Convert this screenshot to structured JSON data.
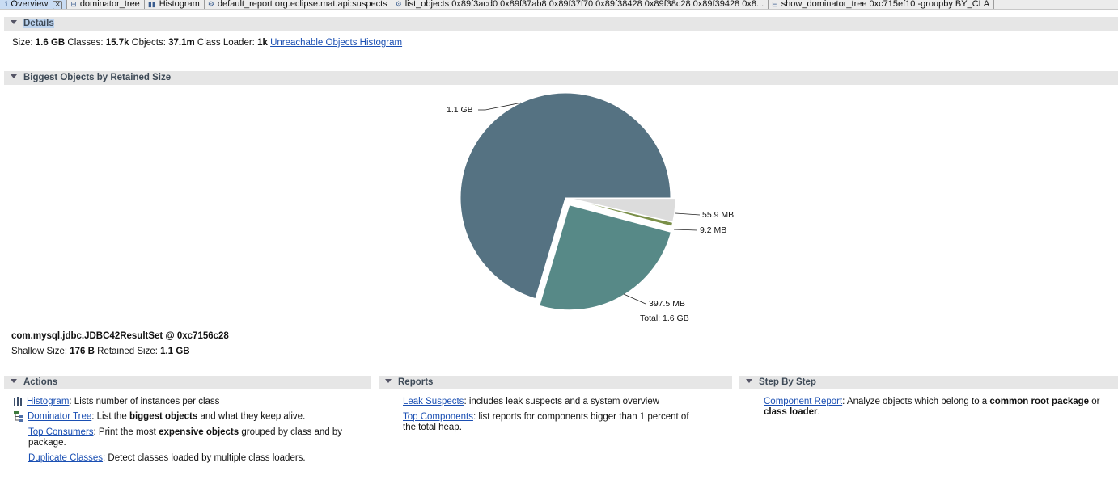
{
  "tabs": [
    {
      "label": "Overview",
      "icon": "overview-icon",
      "active": true
    },
    {
      "label": "dominator_tree",
      "icon": "tree-icon"
    },
    {
      "label": "Histogram",
      "icon": "histogram-icon"
    },
    {
      "label": "default_report  org.eclipse.mat.api:suspects",
      "icon": "report-icon"
    },
    {
      "label": "list_objects 0x89f3acd0 0x89f37ab8 0x89f37f70 0x89f38428 0x89f38c28 0x89f39428 0x8...",
      "icon": "list-icon"
    },
    {
      "label": "show_dominator_tree 0xc715ef10  -groupby BY_CLA",
      "icon": "tree-icon"
    }
  ],
  "details": {
    "header": "Details",
    "size_label": "Size:",
    "size_value": "1.6 GB",
    "classes_label": "Classes:",
    "classes_value": "15.7k",
    "objects_label": "Objects:",
    "objects_value": "37.1m",
    "loader_label": "Class Loader:",
    "loader_value": "1k",
    "link": "Unreachable Objects Histogram"
  },
  "biggest": {
    "header": "Biggest Objects by Retained Size",
    "total": "Total: 1.6 GB",
    "selected_object": "com.mysql.jdbc.JDBC42ResultSet @ 0xc7156c28",
    "shallow_label": "Shallow Size:",
    "shallow_value": "176 B",
    "retained_label": "Retained Size:",
    "retained_value": "1.1 GB"
  },
  "chart_data": {
    "type": "pie",
    "title": "",
    "slices": [
      {
        "label": "1.1 GB",
        "value": 1100,
        "color": "#557282"
      },
      {
        "label": "397.5 MB",
        "value": 397.5,
        "color": "#578987",
        "exploded": true
      },
      {
        "label": "9.2 MB",
        "value": 9.2,
        "color": "#7a8f48"
      },
      {
        "label": "55.9 MB",
        "value": 55.9,
        "color": "#dcdcdc"
      }
    ],
    "total_label": "Total: 1.6 GB"
  },
  "actions": {
    "header": "Actions",
    "items": [
      {
        "link": "Histogram",
        "text": ": Lists number of instances per class",
        "icon": "histogram-icon"
      },
      {
        "link": "Dominator Tree",
        "text_pre": ": List the ",
        "bold": "biggest objects",
        "text_post": " and what they keep alive.",
        "icon": "tree-icon"
      },
      {
        "link": "Top Consumers",
        "text_pre": ": Print the most ",
        "bold": "expensive objects",
        "text_post": " grouped by class and by",
        "text_line2": "package."
      },
      {
        "link": "Duplicate Classes",
        "text": ": Detect classes loaded by multiple class loaders."
      }
    ]
  },
  "reports": {
    "header": "Reports",
    "items": [
      {
        "link": "Leak Suspects",
        "text": ": includes leak suspects and a system overview"
      },
      {
        "link": "Top Components",
        "text": ": list reports for components bigger than 1 percent of",
        "text_line2": "the total heap."
      }
    ]
  },
  "stepbystep": {
    "header": "Step By Step",
    "link": "Component Report",
    "text_pre": ": Analyze objects which belong to a ",
    "bold1": "common root package",
    "mid": " or",
    "bold2": "class loader",
    "end": "."
  }
}
